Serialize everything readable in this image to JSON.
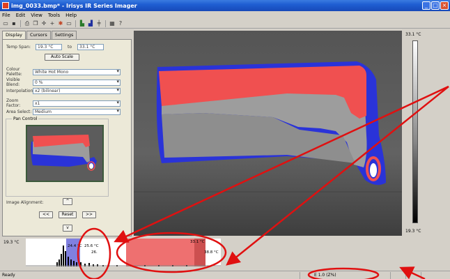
{
  "window": {
    "title": "img_0033.bmp* - Irisys IR Series Imager"
  },
  "menu": [
    "File",
    "Edit",
    "View",
    "Tools",
    "Help"
  ],
  "toolbar": {
    "icons": [
      "open-icon",
      "save-icon",
      "print-icon",
      "copy-icon",
      "crosshair-icon",
      "add-icon",
      "palette-icon",
      "rectangle-icon",
      "chart-icon",
      "histogram-icon",
      "grid-icon",
      "help-icon"
    ]
  },
  "tabs": [
    "Display",
    "Cursors",
    "Settings"
  ],
  "display": {
    "temp_span_label": "Temp Span:",
    "temp_min": "19.3 °C",
    "to_label": "to",
    "temp_max": "33.1 °C",
    "auto_scale_label": "Auto Scale",
    "colour_palette_label": "Colour Palette:",
    "colour_palette_value": "White Hot Mono",
    "visible_blend_label": "Visible Blend:",
    "visible_blend_value": "0 %",
    "interpolation_label": "Interpolation:",
    "interpolation_value": "x2 (bilinear)",
    "zoom_factor_label": "Zoom Factor:",
    "zoom_factor_value": "x1",
    "area_select_label": "Area Select:",
    "area_select_value": "Medium",
    "pan_control_label": "Pan Control",
    "image_alignment_label": "Image Alignment:",
    "up_label": "^",
    "left_label": "<<",
    "reset_label": "Reset",
    "right_label": ">>",
    "down_label": "v"
  },
  "scale": {
    "max_label": "33.1 °C",
    "min_label": "19.3 °C"
  },
  "histogram": {
    "min_label": "19.3 °C",
    "mark1_label": "24.4 °C",
    "mark2_label": "25.6 °C",
    "mark3_label": "26.",
    "max_label": "33.1 °C",
    "right_label": "38.8 °C"
  },
  "status": {
    "left": "Ready",
    "emissivity": "E 1.0 (Z%)"
  },
  "colors": {
    "hot_overlay": "#f05050",
    "cold_overlay": "#2a33d8",
    "annotation_red": "#e01010"
  }
}
